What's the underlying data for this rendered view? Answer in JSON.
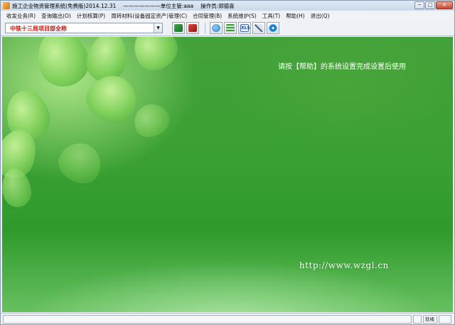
{
  "titlebar": {
    "title": "施工企业物资管理系统(免费版)2014.12.31",
    "unit_label": "———————单位主管:aaa",
    "operator_label": "操作员:郑德喜",
    "minimize": "─",
    "maximize": "□",
    "close": "✕"
  },
  "menu": [
    "收发业务(R)",
    "查询输出(O)",
    "计划核算(P)",
    "周转材料(设备固定资产)管理(C)",
    "合同管理(B)",
    "系统维护(S)",
    "工具(T)",
    "帮助(H)",
    "退出(Q)"
  ],
  "toolbar": {
    "project_value": "中铁十三局项目部全称",
    "dropdown_arrow": "▼",
    "xls_text": "XLS"
  },
  "icons": [
    "green-book-icon",
    "red-book-icon",
    "globe-folder-icon",
    "grid-report-icon",
    "excel-export-icon",
    "tools-icon",
    "ie-browser-icon"
  ],
  "main": {
    "hint": "请按【帮助】的系统设置完成设置后使用",
    "url": "http://www.wzgl.cn"
  },
  "status": {
    "pane_text": "就绪"
  },
  "colors": {
    "accent_red": "#d0150f",
    "background_green": "#3aa033"
  }
}
